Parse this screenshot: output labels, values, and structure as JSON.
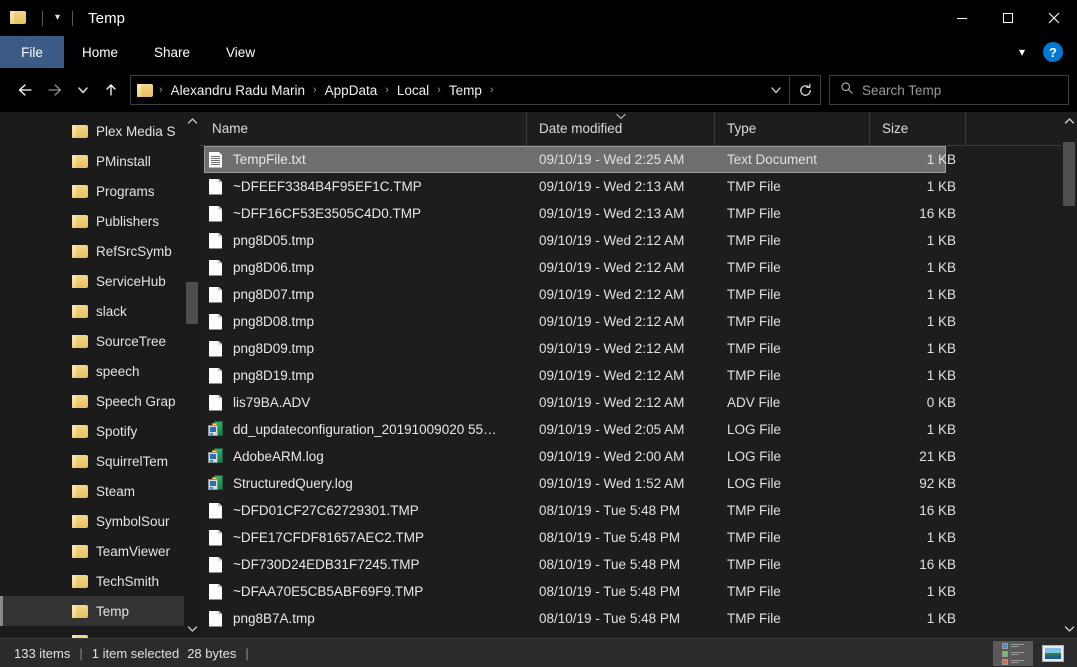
{
  "window": {
    "title": "Temp",
    "quick_access": {
      "folder_icon": "folder-icon",
      "dropdown_icon": "chevron-down-icon"
    },
    "controls": {
      "minimize": "minimize-icon",
      "maximize": "maximize-icon",
      "close": "close-icon"
    }
  },
  "ribbon": {
    "tabs": [
      {
        "label": "File",
        "active": true
      },
      {
        "label": "Home",
        "active": false
      },
      {
        "label": "Share",
        "active": false
      },
      {
        "label": "View",
        "active": false
      }
    ],
    "expand_icon": "chevron-down-icon",
    "help_label": "?"
  },
  "addressbar": {
    "back_icon": "arrow-left-icon",
    "forward_icon": "arrow-right-icon",
    "recent_icon": "chevron-down-icon",
    "up_icon": "arrow-up-icon",
    "path_folder_icon": "folder-icon",
    "breadcrumbs": [
      "Alexandru Radu Marin",
      "AppData",
      "Local",
      "Temp"
    ],
    "separator": "›",
    "dropdown_icon": "chevron-down-icon",
    "refresh_icon": "refresh-icon",
    "search": {
      "icon": "search-icon",
      "placeholder": "Search Temp",
      "value": ""
    }
  },
  "sidebar": {
    "items": [
      {
        "label": "Plex Media S",
        "selected": false
      },
      {
        "label": "PMinstall",
        "selected": false
      },
      {
        "label": "Programs",
        "selected": false
      },
      {
        "label": "Publishers",
        "selected": false
      },
      {
        "label": "RefSrcSymb",
        "selected": false
      },
      {
        "label": "ServiceHub",
        "selected": false
      },
      {
        "label": "slack",
        "selected": false
      },
      {
        "label": "SourceTree",
        "selected": false
      },
      {
        "label": "speech",
        "selected": false
      },
      {
        "label": "Speech Grap",
        "selected": false
      },
      {
        "label": "Spotify",
        "selected": false
      },
      {
        "label": "SquirrelTem",
        "selected": false
      },
      {
        "label": "Steam",
        "selected": false
      },
      {
        "label": "SymbolSour",
        "selected": false
      },
      {
        "label": "TeamViewer",
        "selected": false
      },
      {
        "label": "TechSmith",
        "selected": false
      },
      {
        "label": "Temp",
        "selected": true
      }
    ],
    "scroll_up_icon": "chevron-up-icon",
    "scroll_down_icon": "chevron-down-icon"
  },
  "filelist": {
    "columns": [
      {
        "label": "Name",
        "sorted": false
      },
      {
        "label": "Date modified",
        "sorted": true,
        "sort_icon": "chevron-down-icon"
      },
      {
        "label": "Type",
        "sorted": false
      },
      {
        "label": "Size",
        "sorted": false
      }
    ],
    "rows": [
      {
        "name": "TempFile.txt",
        "date": "09/10/19 - Wed 2:25 AM",
        "type": "Text Document",
        "size": "1 KB",
        "icon": "text-document-icon",
        "selected": true
      },
      {
        "name": "~DFEEF3384B4F95EF1C.TMP",
        "date": "09/10/19 - Wed 2:13 AM",
        "type": "TMP File",
        "size": "1 KB",
        "icon": "generic-file-icon",
        "selected": false
      },
      {
        "name": "~DFF16CF53E3505C4D0.TMP",
        "date": "09/10/19 - Wed 2:13 AM",
        "type": "TMP File",
        "size": "16 KB",
        "icon": "generic-file-icon",
        "selected": false
      },
      {
        "name": "png8D05.tmp",
        "date": "09/10/19 - Wed 2:12 AM",
        "type": "TMP File",
        "size": "1 KB",
        "icon": "generic-file-icon",
        "selected": false
      },
      {
        "name": "png8D06.tmp",
        "date": "09/10/19 - Wed 2:12 AM",
        "type": "TMP File",
        "size": "1 KB",
        "icon": "generic-file-icon",
        "selected": false
      },
      {
        "name": "png8D07.tmp",
        "date": "09/10/19 - Wed 2:12 AM",
        "type": "TMP File",
        "size": "1 KB",
        "icon": "generic-file-icon",
        "selected": false
      },
      {
        "name": "png8D08.tmp",
        "date": "09/10/19 - Wed 2:12 AM",
        "type": "TMP File",
        "size": "1 KB",
        "icon": "generic-file-icon",
        "selected": false
      },
      {
        "name": "png8D09.tmp",
        "date": "09/10/19 - Wed 2:12 AM",
        "type": "TMP File",
        "size": "1 KB",
        "icon": "generic-file-icon",
        "selected": false
      },
      {
        "name": "png8D19.tmp",
        "date": "09/10/19 - Wed 2:12 AM",
        "type": "TMP File",
        "size": "1 KB",
        "icon": "generic-file-icon",
        "selected": false
      },
      {
        "name": "lis79BA.ADV",
        "date": "09/10/19 - Wed 2:12 AM",
        "type": "ADV File",
        "size": "0 KB",
        "icon": "generic-file-icon",
        "selected": false
      },
      {
        "name": "dd_updateconfiguration_20191009020 55…",
        "date": "09/10/19 - Wed 2:05 AM",
        "type": "LOG File",
        "size": "1 KB",
        "icon": "log-file-icon",
        "selected": false
      },
      {
        "name": "AdobeARM.log",
        "date": "09/10/19 - Wed 2:00 AM",
        "type": "LOG File",
        "size": "21 KB",
        "icon": "log-file-icon",
        "selected": false
      },
      {
        "name": "StructuredQuery.log",
        "date": "09/10/19 - Wed 1:52 AM",
        "type": "LOG File",
        "size": "92 KB",
        "icon": "log-file-icon",
        "selected": false
      },
      {
        "name": "~DFD01CF27C62729301.TMP",
        "date": "08/10/19 - Tue 5:48 PM",
        "type": "TMP File",
        "size": "16 KB",
        "icon": "generic-file-icon",
        "selected": false
      },
      {
        "name": "~DFE17CFDF81657AEC2.TMP",
        "date": "08/10/19 - Tue 5:48 PM",
        "type": "TMP File",
        "size": "1 KB",
        "icon": "generic-file-icon",
        "selected": false
      },
      {
        "name": "~DF730D24EDB31F7245.TMP",
        "date": "08/10/19 - Tue 5:48 PM",
        "type": "TMP File",
        "size": "16 KB",
        "icon": "generic-file-icon",
        "selected": false
      },
      {
        "name": "~DFAA70E5CB5ABF69F9.TMP",
        "date": "08/10/19 - Tue 5:48 PM",
        "type": "TMP File",
        "size": "1 KB",
        "icon": "generic-file-icon",
        "selected": false
      },
      {
        "name": "png8B7A.tmp",
        "date": "08/10/19 - Tue 5:48 PM",
        "type": "TMP File",
        "size": "1 KB",
        "icon": "generic-file-icon",
        "selected": false
      }
    ],
    "scroll_up_icon": "chevron-up-icon",
    "scroll_down_icon": "chevron-down-icon"
  },
  "statusbar": {
    "item_count": "133 items",
    "divider": "|",
    "selection": "1 item selected",
    "selection_size": "28 bytes",
    "trailing_divider": "|",
    "view_details_icon": "details-view-icon",
    "view_thumbnails_icon": "large-icons-view-icon"
  },
  "colors": {
    "accent": "#3b5a86",
    "help_blue": "#0078d4",
    "selection": "#6e6e6e",
    "background": "#1d1d1d"
  }
}
